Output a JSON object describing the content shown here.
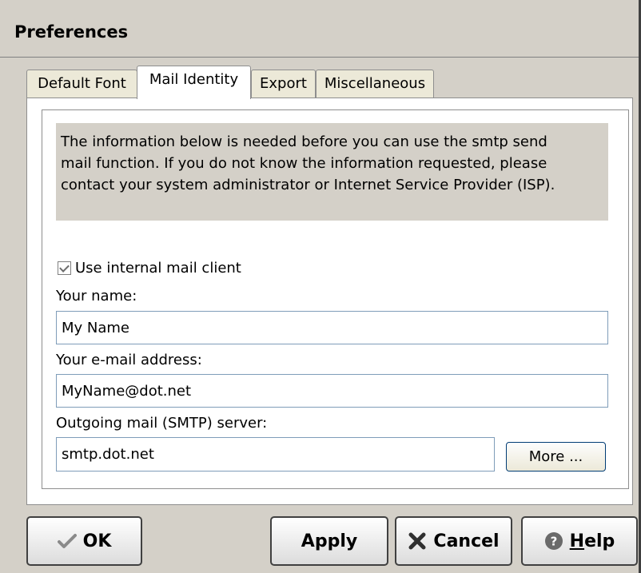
{
  "window": {
    "title": "Preferences"
  },
  "tabs": [
    {
      "label": "Default Font",
      "active": false
    },
    {
      "label": "Mail Identity",
      "active": true
    },
    {
      "label": "Export",
      "active": false
    },
    {
      "label": "Miscellaneous",
      "active": false
    }
  ],
  "info": {
    "line1": "The information below is needed before you can use the smtp send",
    "line2": "mail function. If you do not know the information requested, please",
    "line3": "contact your system administrator or Internet Service Provider (ISP)."
  },
  "form": {
    "use_internal_label": "Use internal mail client",
    "use_internal_checked": true,
    "name_label": "Your name:",
    "name_value": "My Name",
    "email_label": "Your e-mail address:",
    "email_value": "MyName@dot.net",
    "smtp_label": "Outgoing mail (SMTP) server:",
    "smtp_value": "smtp.dot.net",
    "more_label": "More ..."
  },
  "buttons": {
    "ok": "OK",
    "apply": "Apply",
    "cancel": "Cancel",
    "help_underlined": "H",
    "help_rest": "elp"
  },
  "icons": {
    "ok": "checkmark-icon",
    "cancel": "x-icon",
    "help": "question-icon"
  }
}
